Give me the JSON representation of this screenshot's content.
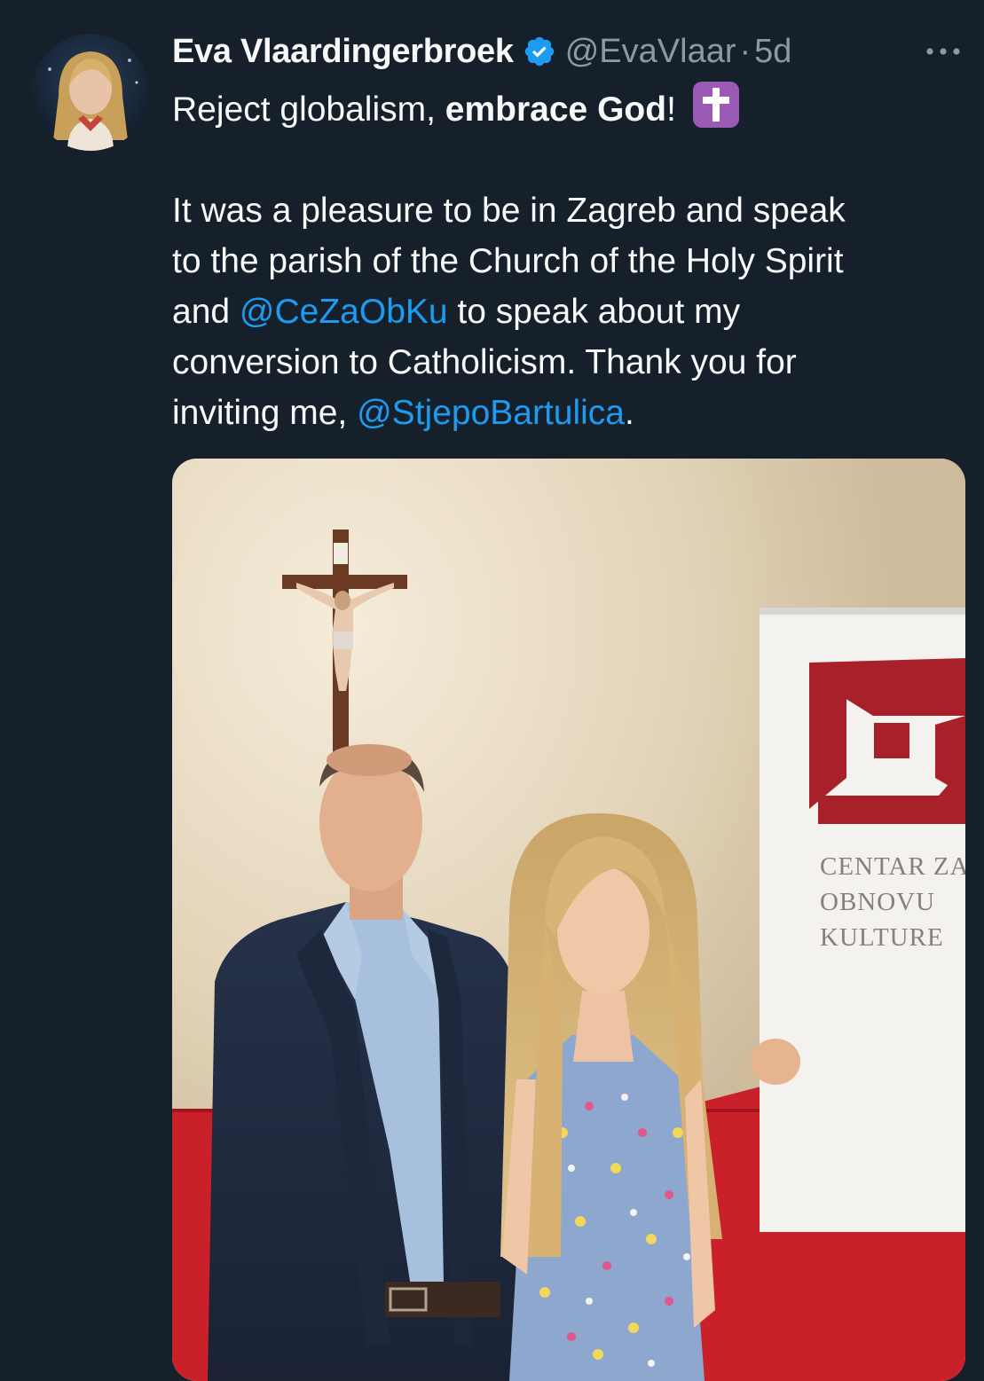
{
  "tweet": {
    "author": {
      "name": "Eva Vlaardingerbroek",
      "handle": "@EvaVlaar",
      "separator": "·",
      "time": "5d"
    },
    "text": {
      "line1_normal": "Reject globalism, ",
      "line1_bold": "embrace God",
      "line1_end": "!",
      "line2": "It was a pleasure to be in Zagreb and speak",
      "line3": "to the parish of the Church of the Holy Spirit",
      "line4_start": "and ",
      "mention1": "@CeZaObKu",
      "line4_end": " to speak about my",
      "line5": "conversion to Catholicism. Thank you for",
      "line6_start": "inviting me, ",
      "mention2": "@StjepoBartulica",
      "line6_end": "."
    },
    "emoji": "latin-cross-emoji",
    "media": {
      "banner_lines": [
        "CENTAR ZA",
        "OBNOVU",
        "KULTURE"
      ]
    }
  },
  "colors": {
    "background": "#15202b",
    "text": "#f7f9f9",
    "muted": "#8b98a5",
    "link": "#1d9bf0",
    "verified": "#1d9bf0",
    "emoji_bg": "#9b59b6"
  },
  "icons": {
    "verified": "verified-badge-icon",
    "more": "more-options-icon"
  }
}
